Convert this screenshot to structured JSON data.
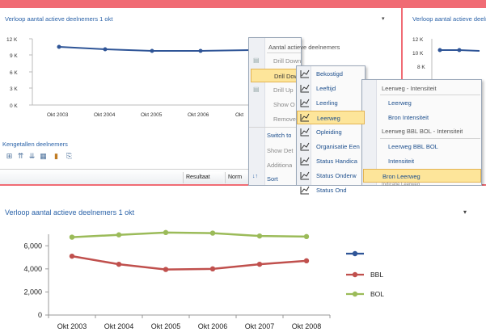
{
  "top_left_panel": {
    "title": "Verloop aantal actieve deelnemers 1 okt",
    "dropdown_arrow": "▾",
    "chart_y_ticks": [
      "12 K",
      "9 K",
      "6 K",
      "3 K",
      "0 K"
    ],
    "chart_x_ticks": [
      "Okt 2003",
      "Okt 2004",
      "Okt 2005",
      "Okt 2006",
      "Okt"
    ]
  },
  "top_right_panel": {
    "title": "Verloop aantal actieve deeln",
    "chart_y_ticks": [
      "12 K",
      "10 K",
      "8 K"
    ]
  },
  "kengetallen": {
    "title": "Kengetallen deelnemers",
    "col_resultaat": "Resultaat",
    "col_norm": "Norm"
  },
  "context_menu": {
    "header": "Aantal actieve deelnemers",
    "items": [
      {
        "label": "Drill Down",
        "state": "disabled"
      },
      {
        "label": "Drill Dow",
        "state": "highlighted"
      },
      {
        "label": "Drill Up",
        "state": "disabled"
      },
      {
        "label": "Show O",
        "state": "disabled"
      },
      {
        "label": "Remove",
        "state": "disabled"
      },
      {
        "label": "Switch to",
        "state": "enabled"
      },
      {
        "label": "Show Det",
        "state": "disabled"
      },
      {
        "label": "Additiona",
        "state": "disabled"
      },
      {
        "label": "Sort",
        "state": "enabled"
      }
    ]
  },
  "submenu": {
    "items": [
      "Bekostigd",
      "Leeftijd",
      "Leerling",
      "Leerweg",
      "Opleiding",
      "Organisatie Een",
      "Status Handica",
      "Status Onderw",
      "Status Ond"
    ],
    "highlighted": "Leerweg"
  },
  "sub_submenu": {
    "group1_header": "Leerweg - Intensiteit",
    "group1_items": [
      "Leerweg",
      "Bron Intensiteit"
    ],
    "group2_header": "Leerweg BBL BOL - Intensiteit",
    "group2_items": [
      "Leerweg BBL BOL",
      "Intensiteit"
    ],
    "highlighted": "Bron Leerweg",
    "cut_item": "Indicatie Leerweg"
  },
  "bottom_panel": {
    "title": "Verloop aantal actieve deelnemers 1 okt",
    "dropdown_arrow": "▾"
  },
  "colors": {
    "line_blue": "#2f5597",
    "line_red": "#c0504d",
    "line_green": "#9bbb59",
    "background": "#f06b74"
  },
  "chart_data": {
    "type": "line",
    "x": [
      "Okt 2003",
      "Okt 2004",
      "Okt 2005",
      "Okt 2006",
      "Okt 2007",
      "Okt 2008"
    ],
    "ylim": [
      0,
      7000
    ],
    "y_ticks": [
      "6,000",
      "4,000",
      "2,000",
      "0"
    ],
    "series": [
      {
        "name": "",
        "color": "#2f5597",
        "values": []
      },
      {
        "name": "BBL",
        "color": "#c0504d",
        "values": [
          5100,
          4400,
          3950,
          4000,
          4400,
          4700
        ]
      },
      {
        "name": "BOL",
        "color": "#9bbb59",
        "values": [
          6750,
          6950,
          7150,
          7100,
          6850,
          6800
        ]
      }
    ]
  }
}
